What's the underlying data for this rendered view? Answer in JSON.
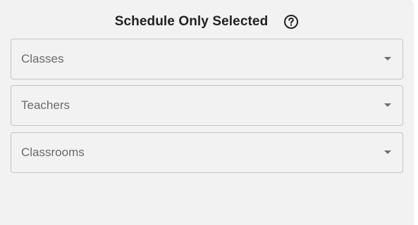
{
  "header": {
    "title": "Schedule Only Selected",
    "help_icon": "question-circle-icon"
  },
  "fields": [
    {
      "label": "Classes",
      "icon": "chevron-down-icon"
    },
    {
      "label": "Teachers",
      "icon": "chevron-down-icon"
    },
    {
      "label": "Classrooms",
      "icon": "chevron-down-icon"
    }
  ],
  "colors": {
    "panel_background": "#f2f2f2",
    "border": "#c4c4c4",
    "title_text": "#222222",
    "label_text": "#6b6b6b"
  }
}
